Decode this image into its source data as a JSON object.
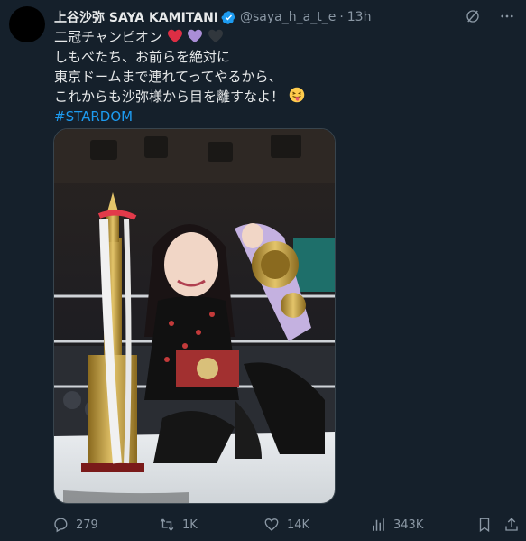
{
  "tweet": {
    "author_name": "上谷沙弥 SAYA KAMITANI",
    "handle": "@saya_h_a_t_e",
    "separator": "·",
    "time": "13h",
    "lines": [
      "二冠チャンピオン",
      "しもべたち、お前らを絶対に",
      "東京ドームまで連れてってやるから、",
      "これからも沙弥様から目を離すなよ！"
    ],
    "hashtag": "#STARDOM",
    "image_alt_icon": "photo-wrestler-with-trophy-and-belt"
  },
  "actions": {
    "replies": "279",
    "reposts": "1K",
    "likes": "14K",
    "views": "343K"
  },
  "colors": {
    "background": "#15202b",
    "text": "#e7e9ea",
    "muted": "#8b98a5",
    "link": "#1d9bf0",
    "verified": "#1d9bf0"
  }
}
